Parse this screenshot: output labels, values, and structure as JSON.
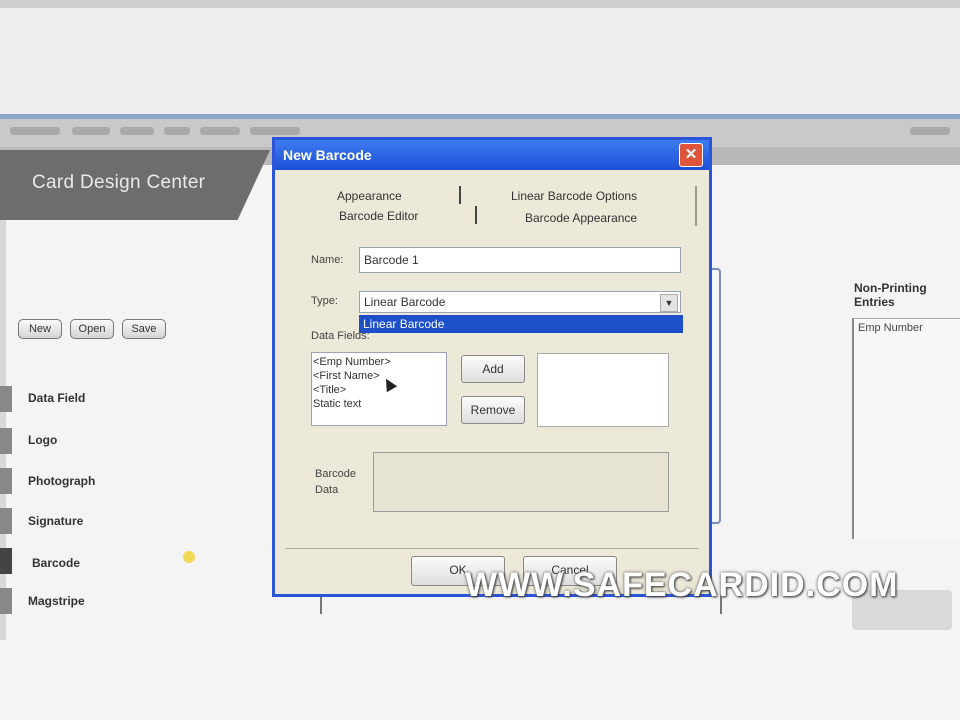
{
  "app": {
    "title": "Card Design Center"
  },
  "file_buttons": [
    "New",
    "Open",
    "Save"
  ],
  "side_items": [
    "Data Field",
    "Logo",
    "Photograph",
    "Signature",
    "Barcode",
    "Magstripe"
  ],
  "right_panel": {
    "title_line1": "Non-Printing",
    "title_line2": "Entries",
    "items": [
      "Emp Number"
    ]
  },
  "dialog": {
    "title": "New Barcode",
    "close_glyph": "✕",
    "tabs": {
      "appearance": "Appearance",
      "linear_options": "Linear Barcode Options",
      "barcode_editor": "Barcode Editor",
      "barcode_appearance": "Barcode Appearance"
    },
    "name_label": "Name:",
    "name_value": "Barcode 1",
    "type_label": "Type:",
    "type_value": "Linear Barcode",
    "type_arrow": "▼",
    "dropdown_option": "Linear Barcode",
    "data_fields_label": "Data Fields:",
    "data_fields": [
      "<Emp Number>",
      "<First Name>",
      "<Title>",
      "Static text"
    ],
    "add_label": "Add",
    "remove_label": "Remove",
    "barcode_data_label_1": "Barcode",
    "barcode_data_label_2": "Data",
    "ok_label": "OK",
    "cancel_label": "Cancel"
  },
  "watermark": "WWW.SAFECARDID.COM",
  "colors": {
    "dialog_border": "#2b55d8",
    "title_bar": "#1c4fd6",
    "selection": "#1d4fc9",
    "close": "#e0553a"
  }
}
